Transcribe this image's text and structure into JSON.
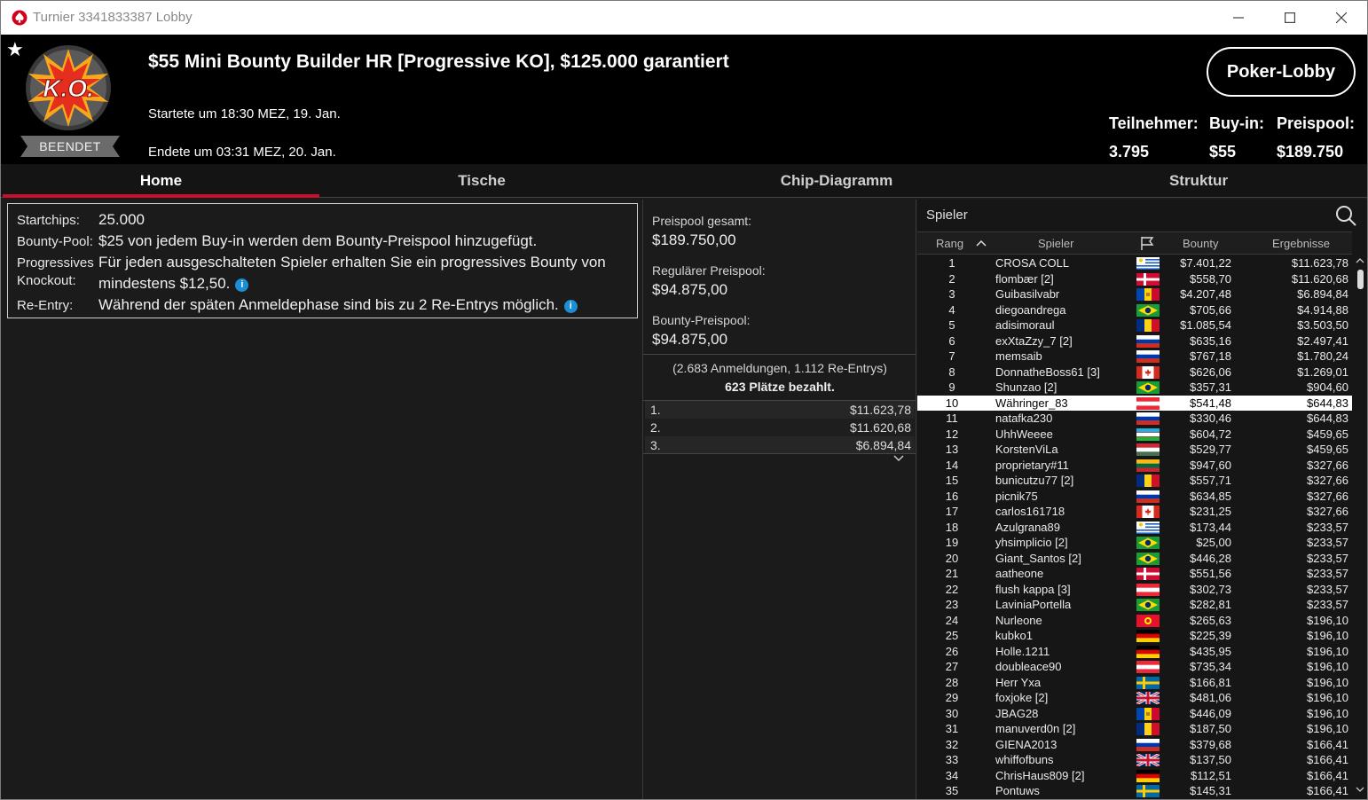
{
  "window": {
    "title": "Turnier 3341833387 Lobby"
  },
  "header": {
    "tournament_name": "$55 Mini Bounty Builder HR [Progressive KO], $125.000 garantiert",
    "started": "Startete um 18:30 MEZ, 19. Jan.",
    "ended": "Endete um 03:31 MEZ, 20. Jan.",
    "status": "BEENDET",
    "logo_text": "K.O.",
    "lobby_button": "Poker-Lobby",
    "stats": {
      "participants_label": "Teilnehmer:",
      "participants": "3.795",
      "buyin_label": "Buy-in:",
      "buyin": "$55",
      "prizepool_label": "Preispool:",
      "prizepool": "$189.750"
    }
  },
  "tabs": [
    "Home",
    "Tische",
    "Chip-Diagramm",
    "Struktur"
  ],
  "info": {
    "startchips_label": "Startchips:",
    "startchips": "25.000",
    "bountypool_label": "Bounty-Pool:",
    "bountypool": "$25 von jedem Buy-in werden dem Bounty-Preispool hinzugefügt.",
    "progressive_label1": "Progressives",
    "progressive_label2": "Knockout:",
    "progressive_line1": "Für jeden ausgeschalteten Spieler erhalten Sie ein progressives Bounty von",
    "progressive_line2": "mindestens $12,50.",
    "reentry_label": "Re-Entry:",
    "reentry": "Während der späten Anmeldephase sind bis zu 2 Re-Entrys möglich."
  },
  "prizepool": {
    "total_label": "Preispool gesamt:",
    "total": "$189.750,00",
    "regular_label": "Regulärer Preispool:",
    "regular": "$94.875,00",
    "bounty_label": "Bounty-Preispool:",
    "bounty": "$94.875,00",
    "registrations": "(2.683 Anmeldungen, 1.112 Re-Entrys)",
    "paid": "623 Plätze bezahlt.",
    "payouts": [
      {
        "pos": "1.",
        "amount": "$11.623,78"
      },
      {
        "pos": "2.",
        "amount": "$11.620,68"
      },
      {
        "pos": "3.",
        "amount": "$6.894,84"
      }
    ]
  },
  "players": {
    "search_label": "Spieler",
    "columns": {
      "rank": "Rang",
      "player": "Spieler",
      "bounty": "Bounty",
      "result": "Ergebnisse"
    },
    "highlighted_rank": "10",
    "rows": [
      {
        "rank": "1",
        "name": "CROSA COLL",
        "flag": "uy",
        "bounty": "$7.401,22",
        "result": "$11.623,78"
      },
      {
        "rank": "2",
        "name": "flombær [2]",
        "flag": "dk",
        "bounty": "$558,70",
        "result": "$11.620,68"
      },
      {
        "rank": "3",
        "name": "Guibasilvabr",
        "flag": "md",
        "bounty": "$4.207,48",
        "result": "$6.894,84"
      },
      {
        "rank": "4",
        "name": "diegoandrega",
        "flag": "br",
        "bounty": "$705,66",
        "result": "$4.914,88"
      },
      {
        "rank": "5",
        "name": "adisimoraul",
        "flag": "ro",
        "bounty": "$1.085,54",
        "result": "$3.503,50"
      },
      {
        "rank": "6",
        "name": "exXtaZzy_7 [2]",
        "flag": "ru",
        "bounty": "$635,16",
        "result": "$2.497,41"
      },
      {
        "rank": "7",
        "name": "memsaib",
        "flag": "ru",
        "bounty": "$767,18",
        "result": "$1.780,24"
      },
      {
        "rank": "8",
        "name": "DonnatheBoss61 [3]",
        "flag": "ca",
        "bounty": "$626,06",
        "result": "$1.269,01"
      },
      {
        "rank": "9",
        "name": "Shunzao [2]",
        "flag": "br",
        "bounty": "$357,31",
        "result": "$904,60"
      },
      {
        "rank": "10",
        "name": "Währinger_83",
        "flag": "at",
        "bounty": "$541,48",
        "result": "$644,83"
      },
      {
        "rank": "11",
        "name": "natafka230",
        "flag": "ru",
        "bounty": "$330,46",
        "result": "$644,83"
      },
      {
        "rank": "12",
        "name": "UhhWeeee",
        "flag": "uz",
        "bounty": "$604,72",
        "result": "$459,65"
      },
      {
        "rank": "13",
        "name": "KorstenViLa",
        "flag": "hu",
        "bounty": "$529,77",
        "result": "$459,65"
      },
      {
        "rank": "14",
        "name": "proprietary#11",
        "flag": "lt",
        "bounty": "$947,60",
        "result": "$327,66"
      },
      {
        "rank": "15",
        "name": "bunicutzu77 [2]",
        "flag": "ro",
        "bounty": "$557,71",
        "result": "$327,66"
      },
      {
        "rank": "16",
        "name": "picnik75",
        "flag": "ru",
        "bounty": "$634,85",
        "result": "$327,66"
      },
      {
        "rank": "17",
        "name": "carlos161718",
        "flag": "ca",
        "bounty": "$231,25",
        "result": "$327,66"
      },
      {
        "rank": "18",
        "name": "Azulgrana89",
        "flag": "uy",
        "bounty": "$173,44",
        "result": "$233,57"
      },
      {
        "rank": "19",
        "name": "yhsimplicio [2]",
        "flag": "br",
        "bounty": "$25,00",
        "result": "$233,57"
      },
      {
        "rank": "20",
        "name": "Giant_Santos [2]",
        "flag": "br",
        "bounty": "$446,28",
        "result": "$233,57"
      },
      {
        "rank": "21",
        "name": "aatheone",
        "flag": "dk",
        "bounty": "$551,56",
        "result": "$233,57"
      },
      {
        "rank": "22",
        "name": "flush kappa [3]",
        "flag": "at",
        "bounty": "$302,73",
        "result": "$233,57"
      },
      {
        "rank": "23",
        "name": "LaviniaPortella",
        "flag": "br",
        "bounty": "$282,81",
        "result": "$233,57"
      },
      {
        "rank": "24",
        "name": "Nurleone",
        "flag": "kg",
        "bounty": "$265,63",
        "result": "$196,10"
      },
      {
        "rank": "25",
        "name": "kubko1",
        "flag": "de",
        "bounty": "$225,39",
        "result": "$196,10"
      },
      {
        "rank": "26",
        "name": "Holle.1211",
        "flag": "de",
        "bounty": "$435,95",
        "result": "$196,10"
      },
      {
        "rank": "27",
        "name": "doubleace90",
        "flag": "at",
        "bounty": "$735,34",
        "result": "$196,10"
      },
      {
        "rank": "28",
        "name": "Herr Yxa",
        "flag": "se",
        "bounty": "$166,81",
        "result": "$196,10"
      },
      {
        "rank": "29",
        "name": "foxjoke [2]",
        "flag": "gb",
        "bounty": "$481,06",
        "result": "$196,10"
      },
      {
        "rank": "30",
        "name": "JBAG28",
        "flag": "md",
        "bounty": "$446,09",
        "result": "$196,10"
      },
      {
        "rank": "31",
        "name": "manuverd0n [2]",
        "flag": "ro",
        "bounty": "$187,50",
        "result": "$196,10"
      },
      {
        "rank": "32",
        "name": "GIENA2013",
        "flag": "ru",
        "bounty": "$379,68",
        "result": "$166,41"
      },
      {
        "rank": "33",
        "name": "whiffofbuns",
        "flag": "gb",
        "bounty": "$137,50",
        "result": "$166,41"
      },
      {
        "rank": "34",
        "name": "ChrisHaus809 [2]",
        "flag": "de",
        "bounty": "$112,51",
        "result": "$166,41"
      },
      {
        "rank": "35",
        "name": "Pontuws",
        "flag": "se",
        "bounty": "$145,31",
        "result": "$166,41"
      }
    ]
  },
  "colors": {
    "accent_red": "#c8102e",
    "info_blue": "#1a8fd6",
    "header_bg": "#000000",
    "panel_bg": "#1b1b1b"
  }
}
